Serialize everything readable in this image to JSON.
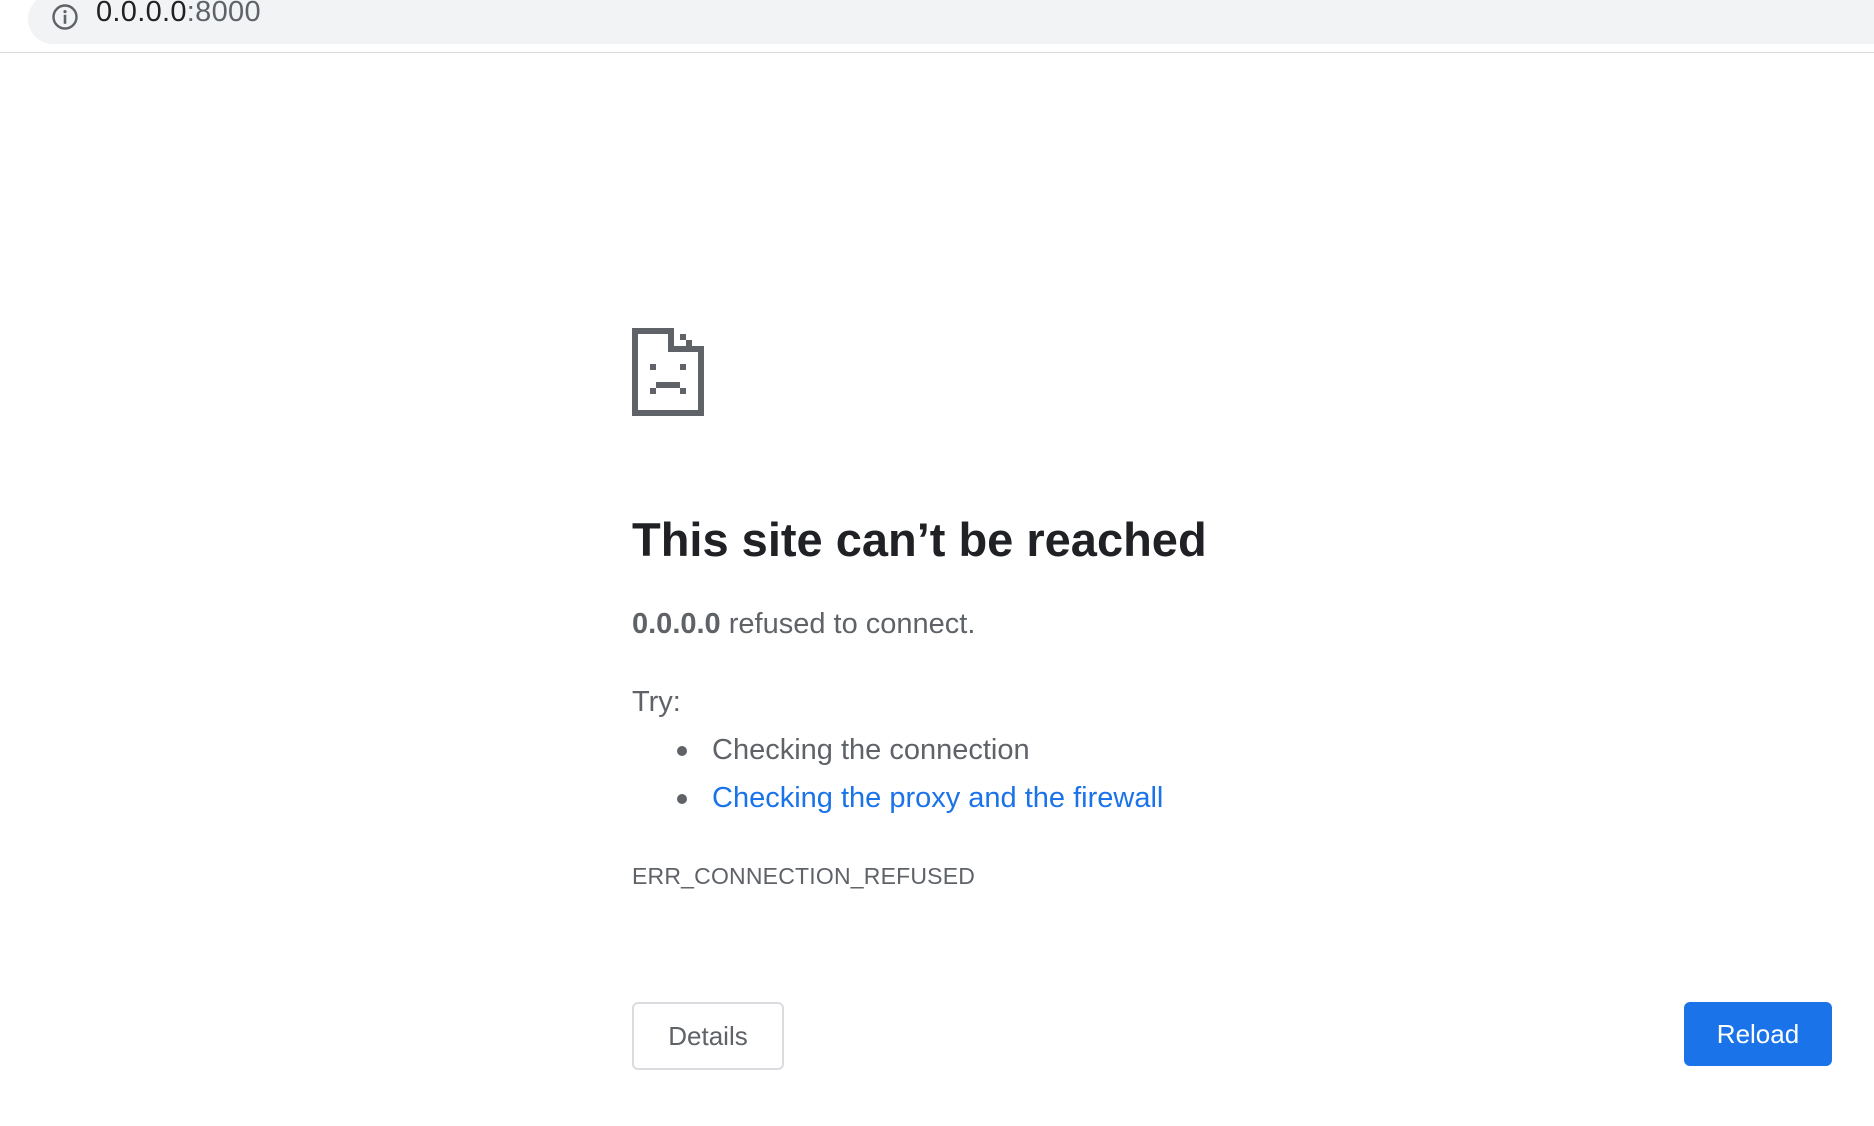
{
  "address_bar": {
    "host": "0.0.0.0",
    "port": ":8000",
    "security_icon": "info-icon"
  },
  "error": {
    "icon": "sad-page-icon",
    "title": "This site can’t be reached",
    "summary_host": "0.0.0.0",
    "summary_rest": " refused to connect.",
    "try_label": "Try:",
    "suggestions": [
      {
        "text": "Checking the connection",
        "is_link": false
      },
      {
        "text": "Checking the proxy and the firewall",
        "is_link": true
      }
    ],
    "code": "ERR_CONNECTION_REFUSED"
  },
  "buttons": {
    "details_label": "Details",
    "reload_label": "Reload"
  },
  "colors": {
    "accent": "#1a73e8",
    "text_primary": "#202124",
    "text_secondary": "#5f6368",
    "omnibox_bg": "#f1f3f4"
  }
}
